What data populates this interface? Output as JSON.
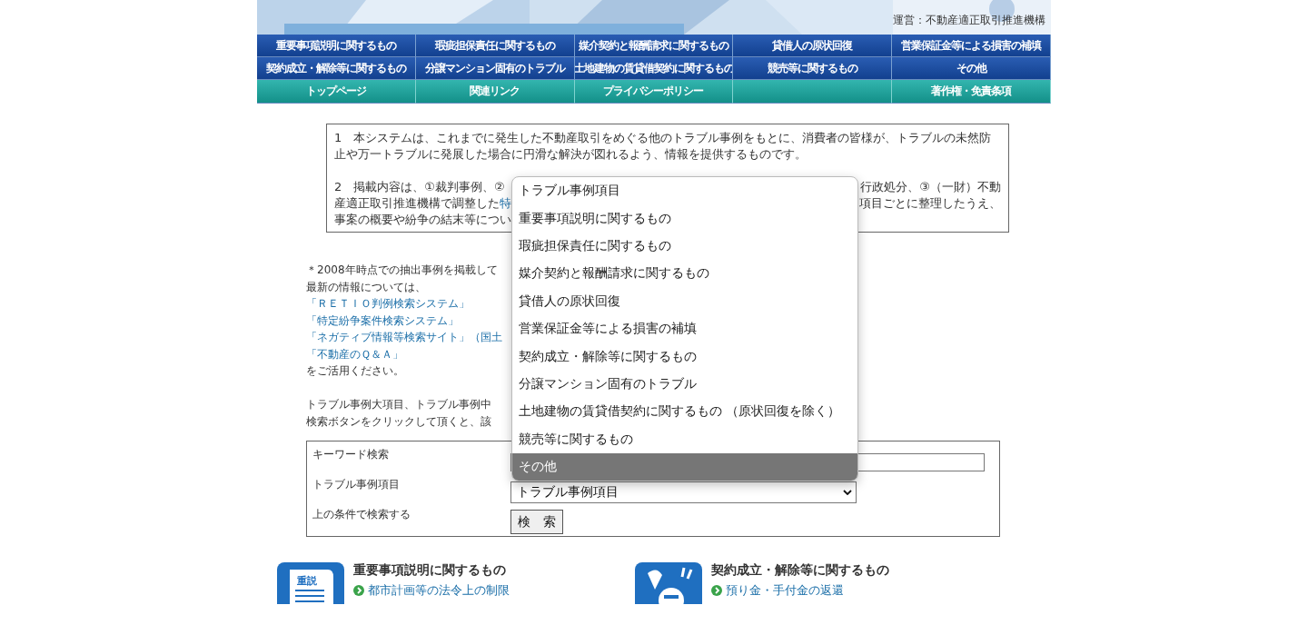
{
  "header": {
    "operator": "運営：不動産適正取引推進機構"
  },
  "nav_rows": [
    {
      "kind": "category",
      "items": [
        {
          "label": "重要事項説明に関するもの"
        },
        {
          "label": "瑕疵担保責任に関するもの"
        },
        {
          "label": "媒介契約と報酬請求に関するもの"
        },
        {
          "label": "貸借人の原状回復"
        },
        {
          "label": "営業保証金等による損害の補填"
        }
      ]
    },
    {
      "kind": "category",
      "items": [
        {
          "label": "契約成立・解除等に関するもの"
        },
        {
          "label": "分譲マンション固有のトラブル"
        },
        {
          "label": "土地建物の賃貸借契約に関するもの"
        },
        {
          "label": "競売等に関するもの"
        },
        {
          "label": "その他"
        }
      ]
    },
    {
      "kind": "site",
      "items": [
        {
          "kind": "link",
          "label": "トップページ"
        },
        {
          "kind": "link",
          "label": "関連リンク"
        },
        {
          "kind": "link",
          "label": "プライバシーポリシー"
        },
        {
          "kind": "blank"
        },
        {
          "kind": "link",
          "label": "著作権・免責条項"
        }
      ]
    }
  ],
  "notice": {
    "paragraph_1": "1　本システムは、これまでに発生した不動産取引をめぐる他のトラブル事例をもとに、消費者の皆様が、トラブルの未然防止や万一トラブルに発展した場合に円滑な解決が図れるよう、情報を提供するものです。",
    "paragraph_2_lines": [
      {
        "left": [
          {
            "text": "2　掲載内容は、①裁判事例、②",
            "link": false
          }
        ],
        "right": "行政処分、③（一財）不動"
      },
      {
        "left": [
          {
            "text": "産適正取引推進機構で調整した",
            "link": false
          },
          {
            "text": "特",
            "link": true
          }
        ],
        "right": "項目ごとに整理したうえ、"
      },
      {
        "left": [
          {
            "text": "事案の概要や紛争の結末等につい",
            "link": false
          }
        ]
      }
    ]
  },
  "info_paragraphs": [
    [
      {
        "text": "＊2008年時点での抽出事例を掲載して",
        "link": false
      },
      {
        "text": "最新の情報については、",
        "link": false
      },
      {
        "text": "「ＲＥＴＩＯ判例検索システム」",
        "link": true
      },
      {
        "text": "「特定紛争案件検索システム」",
        "link": true
      },
      {
        "text": "「ネガティブ情報等検索サイト」（国土",
        "link": true
      },
      {
        "text": "「不動産のＱ＆Ａ」",
        "link": true
      },
      {
        "text": "をご活用ください。",
        "link": false
      }
    ],
    [
      {
        "text": "トラブル事例大項目、トラブル事例中",
        "link": false
      },
      {
        "text": "検索ボタンをクリックして頂くと、該",
        "link": false
      }
    ]
  ],
  "search": {
    "keyword_label": "キーワード検索",
    "category_label": "トラブル事例項目",
    "category_value": "トラブル事例項目",
    "submit_label": "上の条件で検索する",
    "submit_button": "検　索"
  },
  "dropdown_options": [
    {
      "label": "トラブル事例項目",
      "selected": false
    },
    {
      "label": "重要事項説明に関するもの",
      "selected": false
    },
    {
      "label": "瑕疵担保責任に関するもの",
      "selected": false
    },
    {
      "label": "媒介契約と報酬請求に関するもの",
      "selected": false
    },
    {
      "label": "貸借人の原状回復",
      "selected": false
    },
    {
      "label": "営業保証金等による損害の補填",
      "selected": false
    },
    {
      "label": "契約成立・解除等に関するもの",
      "selected": false
    },
    {
      "label": "分譲マンション固有のトラブル",
      "selected": false
    },
    {
      "label": "土地建物の賃貸借契約に関するもの （原状回復を除く）",
      "selected": false
    },
    {
      "label": "競売等に関するもの",
      "selected": false
    },
    {
      "label": "その他",
      "selected": true
    }
  ],
  "categories": [
    {
      "kind": "document",
      "badge": "重説",
      "title": "重要事項説明に関するもの",
      "items": [
        "都市計画等の法令上の制限"
      ]
    },
    {
      "kind": "figure",
      "title": "契約成立・解除等に関するもの",
      "items": [
        "預り金・手付金の返還"
      ]
    }
  ]
}
